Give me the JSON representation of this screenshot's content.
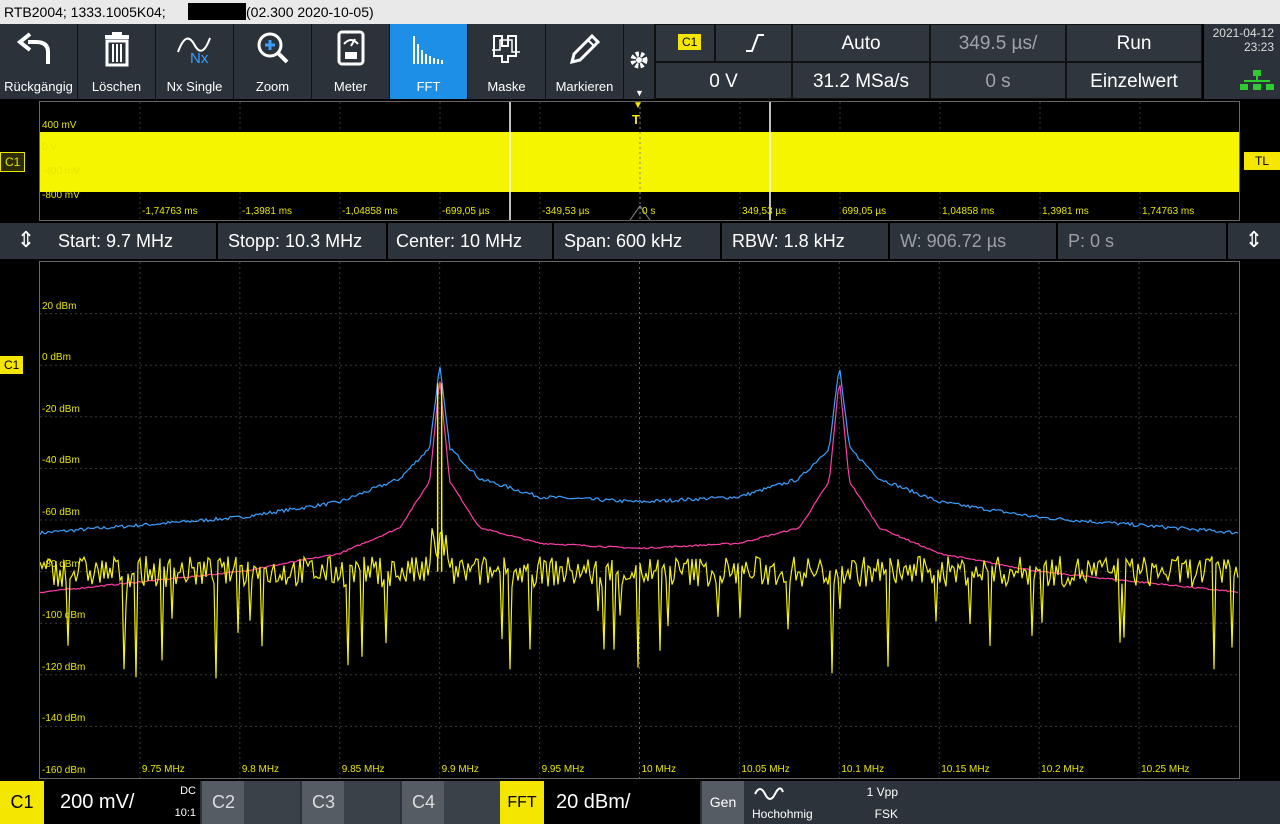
{
  "titlebar": {
    "text": "RTB2004; 1333.1005K04;",
    "suffix": "(02.300 2020-10-05)"
  },
  "toolbar": {
    "undo": {
      "label": "Rückgängig",
      "icon": "undo-arrow-icon"
    },
    "delete": {
      "label": "Löschen",
      "icon": "trash-icon"
    },
    "single": {
      "label": "Nx Single",
      "icon": "nx-single-icon",
      "badge": "Nx"
    },
    "zoom": {
      "label": "Zoom",
      "icon": "magnifier-plus-icon"
    },
    "meter": {
      "label": "Meter",
      "icon": "meter-icon"
    },
    "fft": {
      "label": "FFT",
      "icon": "fft-spectrum-icon"
    },
    "mask": {
      "label": "Maske",
      "icon": "mask-icon"
    },
    "mark": {
      "label": "Markieren",
      "icon": "pencil-icon"
    }
  },
  "trigger": {
    "source": "C1",
    "slope_icon": "rising-edge-icon",
    "level": "0 V",
    "mode": "Auto",
    "samplerate": "31.2 MSa/s",
    "timebase": "349.5 µs/",
    "position": "0 s",
    "run": "Run",
    "single": "Einzelwert"
  },
  "clock": {
    "date": "2021-04-12",
    "time": "23:23"
  },
  "overview": {
    "ylabels": [
      "400 mV",
      "0 V",
      "-400 mV",
      "-800 mV"
    ],
    "xlabels": [
      "-1,74763 ms",
      "-1,3981 ms",
      "-1,04858 ms",
      "-699,05 µs",
      "-349,53 µs",
      "0 s",
      "349,53 µs",
      "699,05 µs",
      "1,04858 ms",
      "1,3981 ms",
      "1,74763 ms"
    ],
    "channel_marker": "C1",
    "trigger_level_marker": "TL",
    "trigger_marker": "T"
  },
  "fft_params": {
    "start": "Start: 9.7 MHz",
    "stop": "Stopp: 10.3 MHz",
    "center": "Center: 10 MHz",
    "span": "Span: 600 kHz",
    "rbw": "RBW: 1.8 kHz",
    "window": "W: 906.72 µs",
    "position": "P: 0 s"
  },
  "spectrum": {
    "channel_marker": "C1",
    "ylabels": [
      "20 dBm",
      "0 dBm",
      "-20 dBm",
      "-40 dBm",
      "-60 dBm",
      "-80 dBm",
      "-100 dBm",
      "-120 dBm",
      "-140 dBm",
      "-160 dBm"
    ],
    "xlabels": [
      "9.75 MHz",
      "9.8 MHz",
      "9.85 MHz",
      "9.9 MHz",
      "9.95 MHz",
      "10 MHz",
      "10.05 MHz",
      "10.1 MHz",
      "10.15 MHz",
      "10.2 MHz",
      "10.25 MHz"
    ]
  },
  "chart_data": {
    "type": "line",
    "x_range_mhz": [
      9.7,
      10.3
    ],
    "ylim_dbm": [
      -160,
      40
    ],
    "grid": true,
    "series": [
      {
        "color": "#3aa0ff",
        "x": [
          9.7,
          9.8,
          9.85,
          9.88,
          9.895,
          9.9,
          9.905,
          9.92,
          9.95,
          10.0,
          10.05,
          10.08,
          10.095,
          10.1,
          10.105,
          10.12,
          10.15,
          10.2,
          10.3
        ],
        "y": [
          -65,
          -59,
          -53,
          -44,
          -32,
          0,
          -32,
          -44,
          -51,
          -53,
          -51,
          -44,
          -32,
          0,
          -32,
          -44,
          -53,
          -59,
          -65
        ]
      },
      {
        "color": "#ff3da8",
        "x": [
          9.7,
          9.8,
          9.85,
          9.88,
          9.895,
          9.9,
          9.905,
          9.92,
          9.95,
          10.0,
          10.05,
          10.08,
          10.095,
          10.1,
          10.105,
          10.12,
          10.15,
          10.2,
          10.3
        ],
        "y": [
          -88,
          -80,
          -73,
          -63,
          -45,
          -5,
          -45,
          -63,
          -69,
          -71,
          -69,
          -63,
          -45,
          -5,
          -45,
          -63,
          -73,
          -80,
          -88
        ]
      },
      {
        "color": "#f5f500",
        "type": "noise",
        "floor_dbm": -80,
        "floor_spread_db": 12,
        "deep_dips_dbm": -110,
        "spikes_at_mhz": [
          9.899,
          9.901
        ],
        "spike_dbm": -7
      }
    ]
  },
  "bottombar": {
    "c1": "C1",
    "c1_scale": "200 mV/",
    "c1_coupling": "DC",
    "c1_probe": "10:1",
    "c2": "C2",
    "c3": "C3",
    "c4": "C4",
    "fft": "FFT",
    "fft_scale": "20 dBm/",
    "gen": "Gen",
    "gen_wave": "sine-wave-icon",
    "gen_amp": "1 Vpp",
    "gen_load": "Hochohmig",
    "gen_mode": "FSK"
  }
}
